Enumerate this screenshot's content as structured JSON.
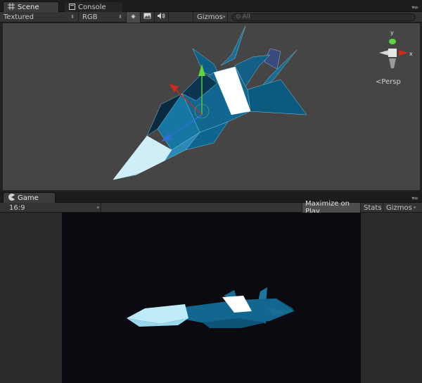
{
  "scene_panel": {
    "tabs": [
      {
        "label": "Scene",
        "icon": "grid-icon",
        "active": true
      },
      {
        "label": "Console",
        "icon": "console-icon",
        "active": false
      }
    ],
    "toolbar": {
      "render_mode": "Textured",
      "color_mode": "RGB",
      "gizmos_label": "Gizmos",
      "search_placeholder": "All",
      "buttons": [
        "sun-lighting-icon",
        "image-icon",
        "audio-speaker-icon"
      ]
    },
    "projection_label": "Persp",
    "orientation_gizmo": {
      "y_label": "y",
      "x_label": "x"
    }
  },
  "game_panel": {
    "tab": {
      "label": "Game",
      "icon": "pacman-icon"
    },
    "toolbar": {
      "aspect": "16:9",
      "maximize_on_play": "Maximize on Play",
      "stats": "Stats",
      "gizmos_label": "Gizmos"
    }
  },
  "colors": {
    "scene_bg": "#454545",
    "game_bg": "#0a0a10",
    "ship_dark": "#105c80",
    "ship_light": "#cfeef8",
    "ship_white": "#ffffff",
    "gizmo_x": "#cc2b1e",
    "gizmo_y": "#58c93a",
    "gizmo_z": "#2f6fd6"
  }
}
